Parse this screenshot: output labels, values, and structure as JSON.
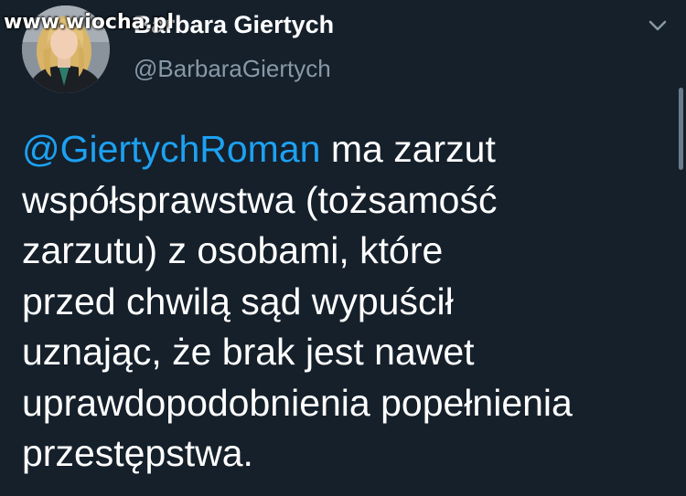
{
  "watermark": "www.wiocha.pl",
  "author": {
    "display_name": "Barbara Giertych",
    "handle": "@BarbaraGiertych"
  },
  "tweet": {
    "mention": "@GiertychRoman",
    "lines": [
      " ma zarzut",
      "współsprawstwa (tożsamość",
      "zarzutu) z osobami, które",
      "przed chwilą sąd wypuścił",
      "uznając, że brak jest nawet",
      "uprawdopodobnienia popełnienia",
      "przestępstwa."
    ]
  },
  "colors": {
    "background": "#15202b",
    "mention": "#1da1f2",
    "secondary_text": "#8899a6"
  },
  "icons": {
    "menu": "chevron-down-icon",
    "avatar": "avatar"
  }
}
